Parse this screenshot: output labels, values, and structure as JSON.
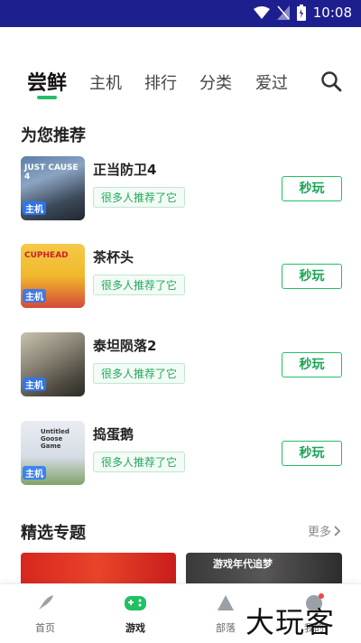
{
  "status_bar": {
    "time": "10:08"
  },
  "tabs": [
    {
      "label": "尝鲜",
      "active": true
    },
    {
      "label": "主机",
      "active": false
    },
    {
      "label": "排行",
      "active": false
    },
    {
      "label": "分类",
      "active": false
    },
    {
      "label": "爱过",
      "active": false
    }
  ],
  "recommend": {
    "title": "为您推荐",
    "games": [
      {
        "name": "正当防卫4",
        "tag": "很多人推荐了它",
        "button": "秒玩",
        "badge": "主机",
        "cover_text": "JUST CAUSE 4"
      },
      {
        "name": "茶杯头",
        "tag": "很多人推荐了它",
        "button": "秒玩",
        "badge": "主机",
        "cover_text": "CUPHEAD"
      },
      {
        "name": "泰坦陨落2",
        "tag": "很多人推荐了它",
        "button": "秒玩",
        "badge": "主机",
        "cover_text": ""
      },
      {
        "name": "捣蛋鹅",
        "tag": "很多人推荐了它",
        "button": "秒玩",
        "badge": "主机",
        "cover_text": "Untitled Goose Game"
      }
    ]
  },
  "featured": {
    "title": "精选专题",
    "more": "更多",
    "banner_right_text": "游戏年代追梦"
  },
  "bottom_nav": [
    {
      "label": "首页",
      "icon": "rocket-icon",
      "active": false
    },
    {
      "label": "游戏",
      "icon": "gamepad-icon",
      "active": true
    },
    {
      "label": "部落",
      "icon": "mountain-icon",
      "active": false
    },
    {
      "label": "我的",
      "icon": "profile-icon",
      "active": false
    }
  ],
  "watermark": "大玩客",
  "colors": {
    "accent": "#22c064",
    "status_bar": "#1e1f8f"
  }
}
